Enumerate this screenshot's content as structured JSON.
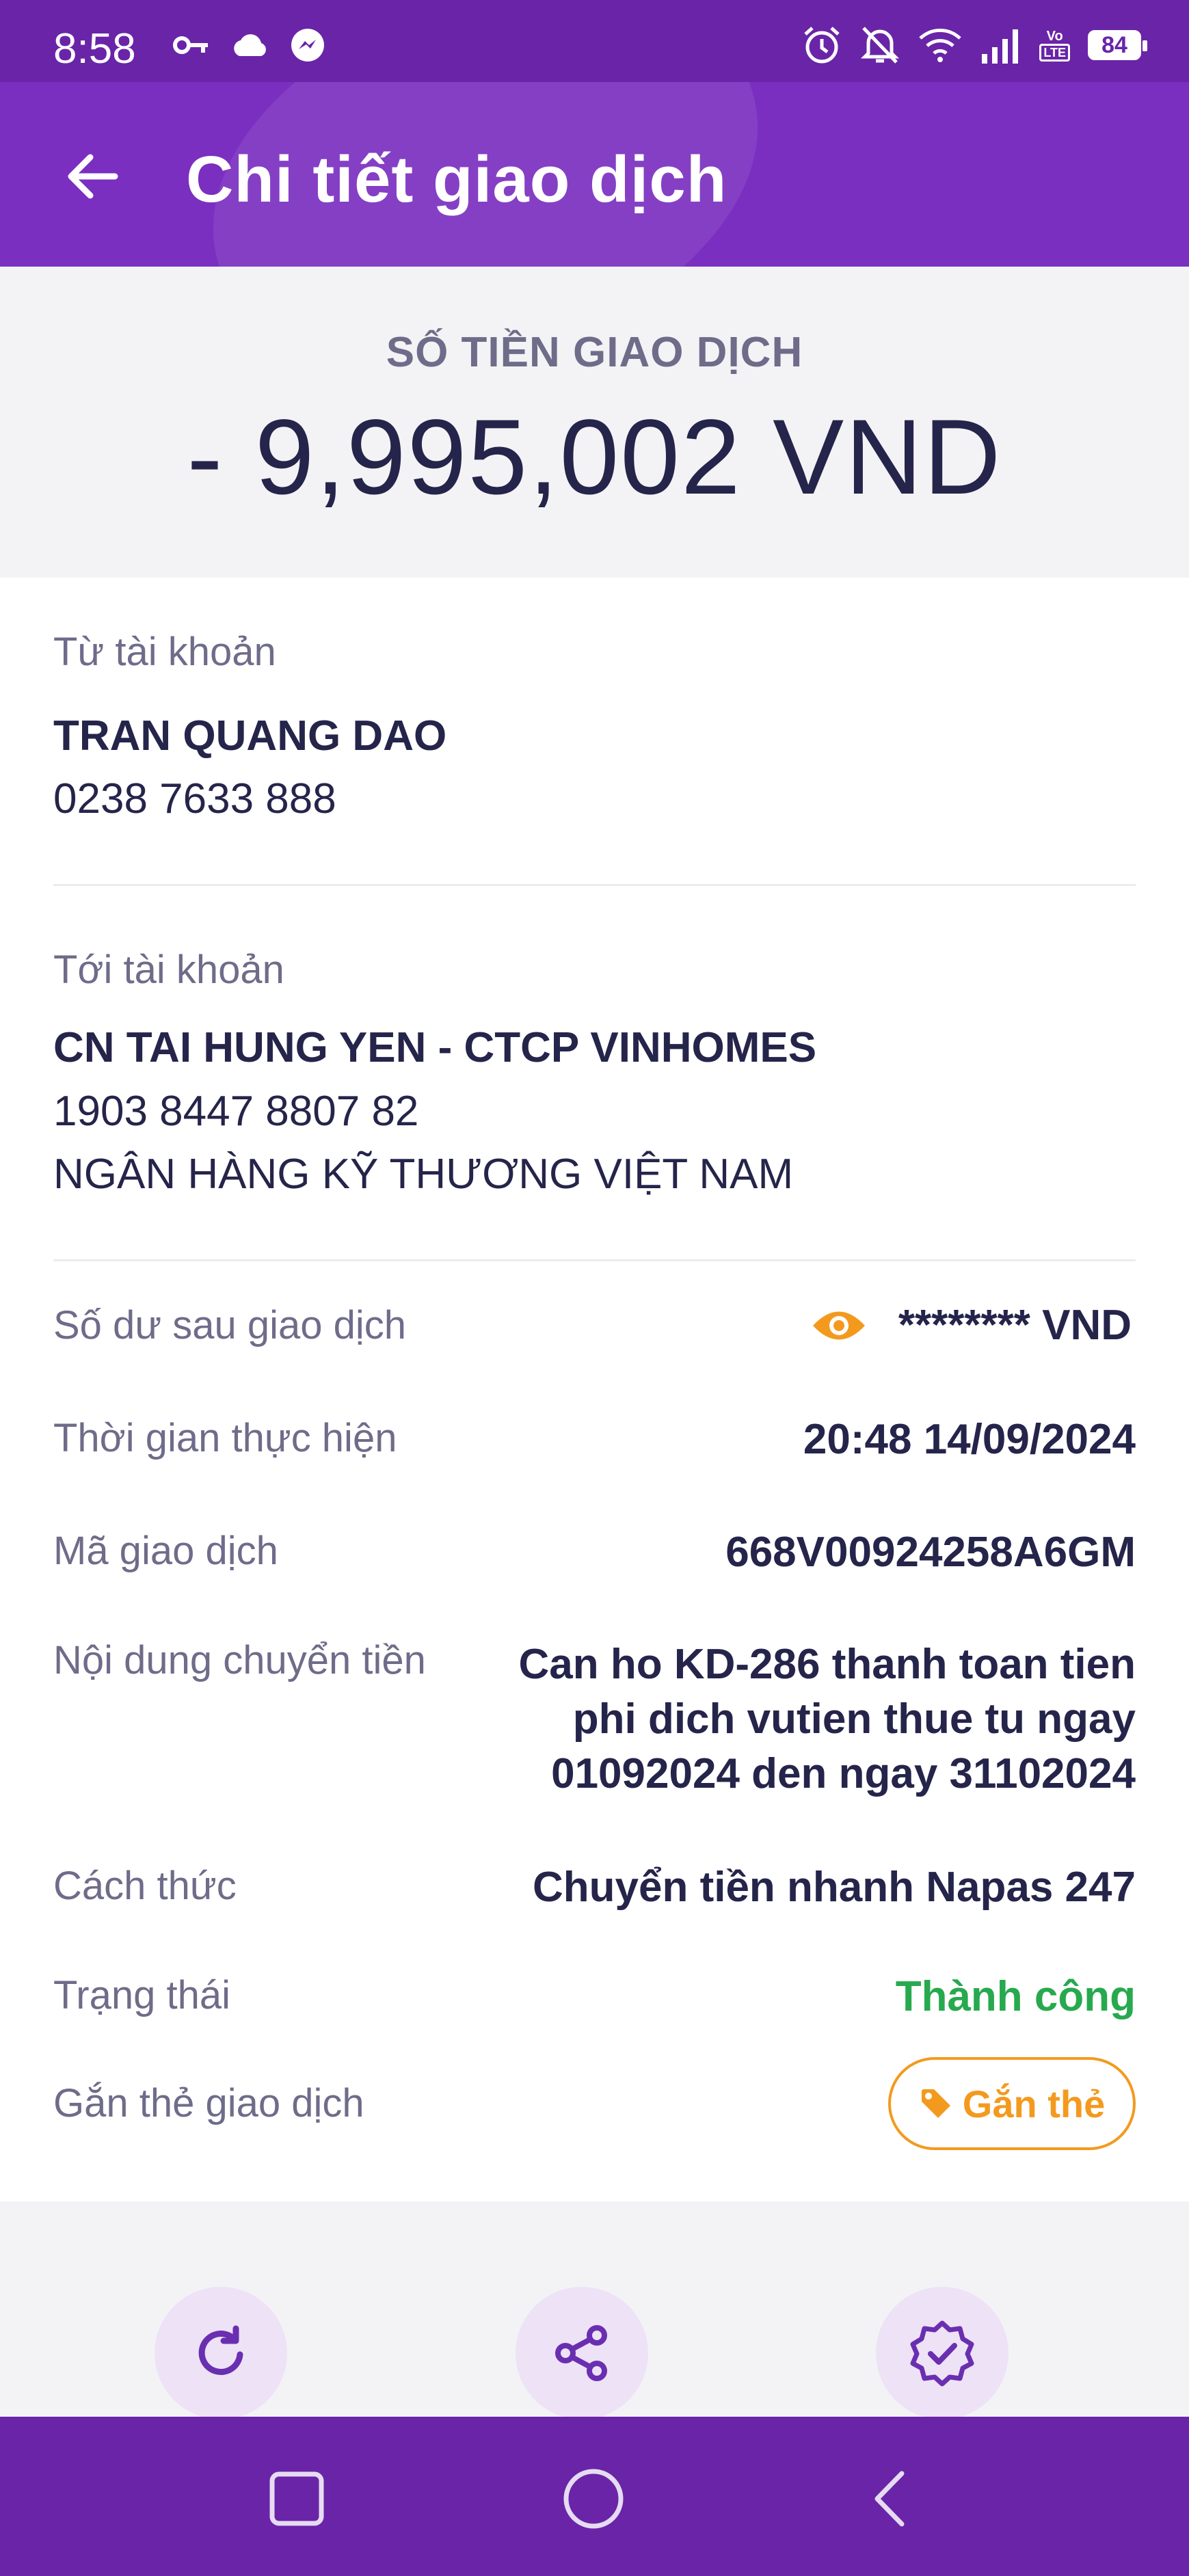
{
  "status_bar": {
    "time": "8:58",
    "left_icons": [
      "key-icon",
      "cloud-icon",
      "messenger-icon"
    ],
    "right_icons": [
      "alarm-icon",
      "bell-off-icon",
      "wifi-icon",
      "signal-icon",
      "volte-icon",
      "battery-icon"
    ],
    "volte_top": "Vo",
    "volte_bottom": "LTE",
    "battery_level": "84"
  },
  "header": {
    "title": "Chi tiết giao dịch",
    "back_icon": "arrow-left-icon"
  },
  "amount": {
    "label": "SỐ TIỀN GIAO DỊCH",
    "value": "- 9,995,002 VND"
  },
  "from_account": {
    "label": "Từ tài khoản",
    "name": "TRAN QUANG DAO",
    "number": "0238 7633 888"
  },
  "to_account": {
    "label": "Tới tài khoản",
    "name": "CN TAI HUNG YEN - CTCP VINHOMES",
    "number": "1903 8447 8807 82",
    "bank": "NGÂN HÀNG KỸ THƯƠNG VIỆT NAM"
  },
  "details": {
    "balance_label": "Số dư sau giao dịch",
    "balance_value": "******** VND",
    "time_label": "Thời gian thực hiện",
    "time_value": "20:48 14/09/2024",
    "code_label": "Mã giao dịch",
    "code_value": "668V00924258A6GM",
    "content_label": "Nội dung chuyển tiền",
    "content_lines": [
      "Can ho KD-286 thanh toan tien",
      "phi dich vutien thue tu ngay",
      "01092024 den ngay 31102024"
    ],
    "method_label": "Cách thức",
    "method_value": "Chuyển tiền nhanh Napas 247",
    "status_label": "Trạng thái",
    "status_value": "Thành công",
    "tag_label": "Gắn thẻ giao dịch",
    "tag_button": "Gắn thẻ"
  },
  "actions": [
    "repeat-icon",
    "share-icon",
    "verified-badge-icon"
  ],
  "nav": [
    "recents-square-icon",
    "home-circle-icon",
    "back-triangle-icon"
  ],
  "colors": {
    "brand": "#7b2fc0",
    "status_bar": "#6a24a8",
    "success": "#27a94e",
    "accent_orange": "#f39a1e",
    "text_dark": "#25244a",
    "text_muted": "#6f6c8a"
  }
}
